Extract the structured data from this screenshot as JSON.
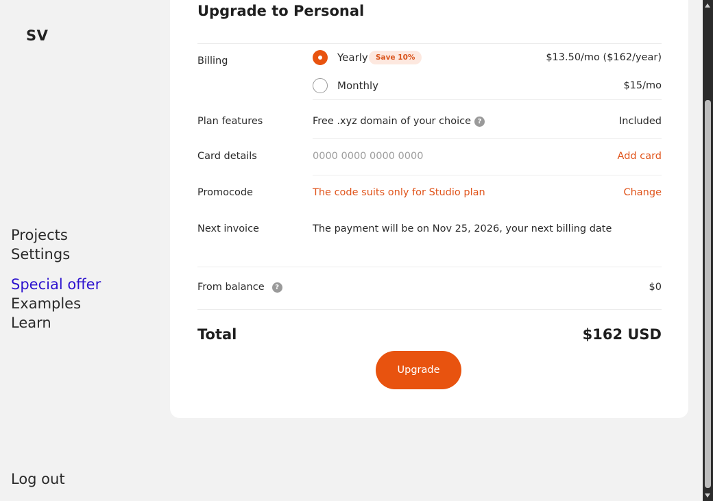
{
  "sidebar": {
    "avatar": "SV",
    "nav_group1": [
      "Projects",
      "Settings"
    ],
    "nav_group2": [
      "Special offer",
      "Examples",
      "Learn"
    ],
    "logout": "Log out"
  },
  "checkout": {
    "title": "Upgrade to Personal",
    "billing": {
      "label": "Billing",
      "yearly": {
        "label": "Yearly",
        "badge": "Save 10%",
        "price": "$13.50/mo ($162/year)",
        "selected": true
      },
      "monthly": {
        "label": "Monthly",
        "price": "$15/mo",
        "selected": false
      }
    },
    "features": {
      "label": "Plan features",
      "value": "Free .xyz domain of your choice",
      "right": "Included"
    },
    "card": {
      "label": "Card details",
      "placeholder": "0000 0000 0000 0000",
      "action": "Add card"
    },
    "promo": {
      "label": "Promocode",
      "message": "The code suits only for Studio plan",
      "action": "Change"
    },
    "invoice": {
      "label": "Next invoice",
      "value": "The payment will be on Nov 25, 2026, your next billing date"
    },
    "balance": {
      "label": "From balance",
      "value": "$0"
    },
    "total": {
      "label": "Total",
      "value": "$162 USD"
    },
    "button": "Upgrade",
    "help_glyph": "?"
  },
  "colors": {
    "accent": "#e8530f",
    "special_link": "#2d13cf",
    "background": "#f2f2f2"
  }
}
